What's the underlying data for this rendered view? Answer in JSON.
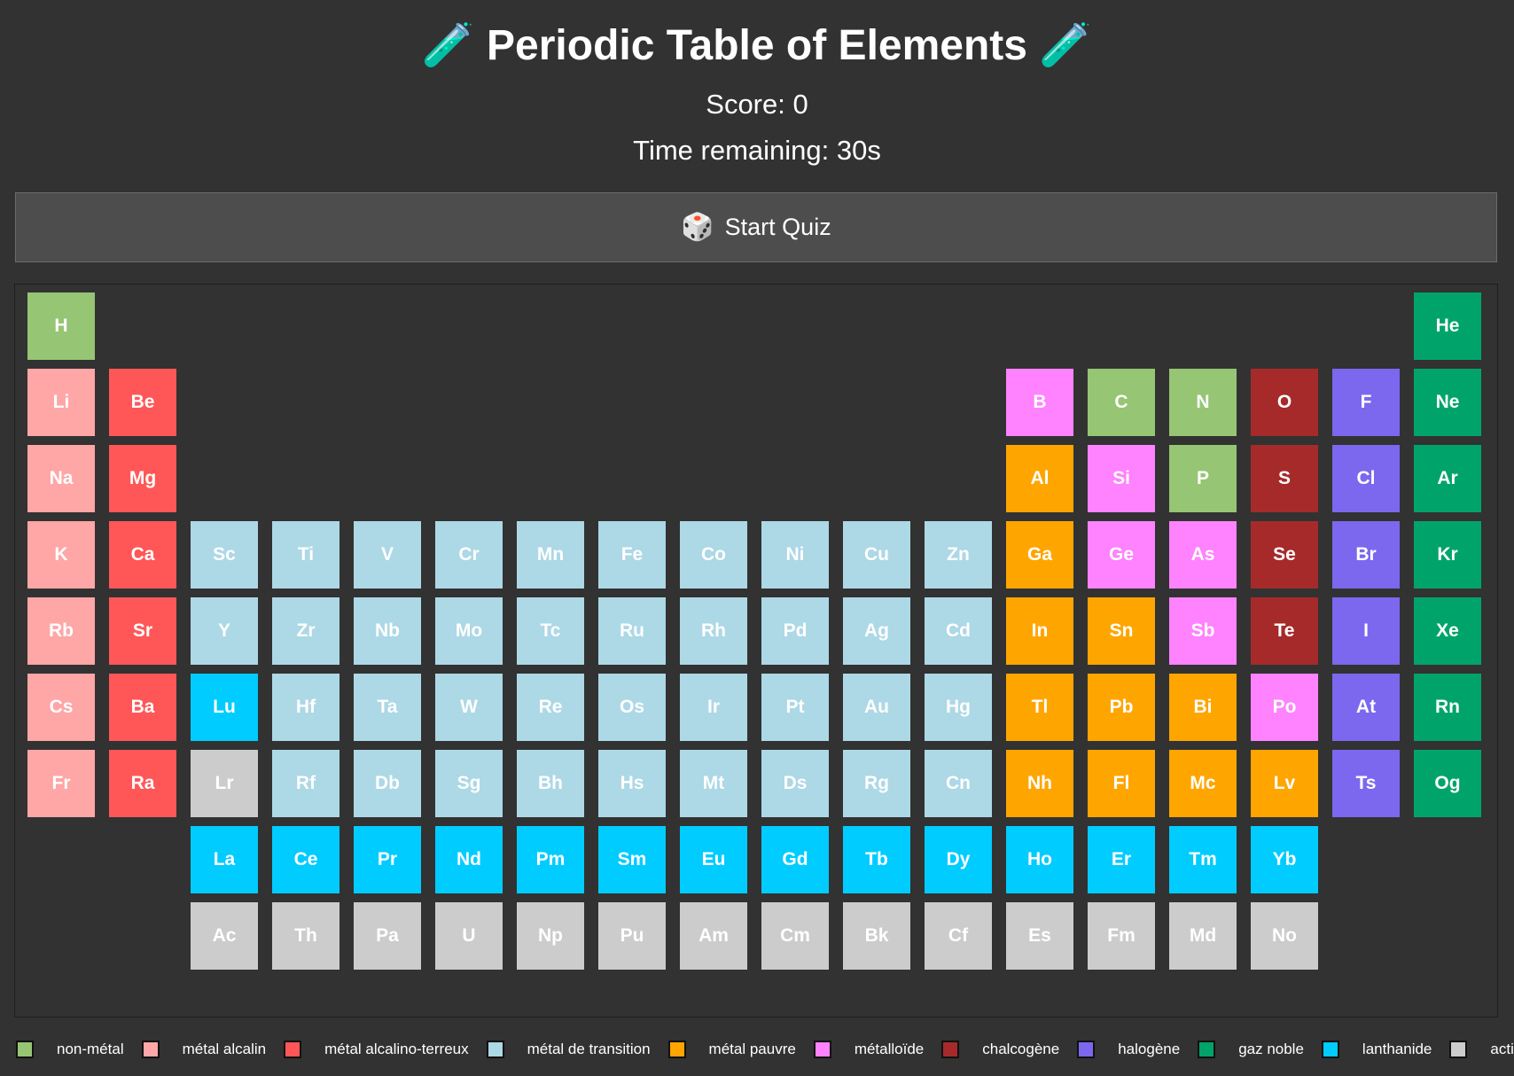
{
  "header": {
    "title_icon": "🧪",
    "title": "Periodic Table of Elements",
    "score_text": "Score: 0",
    "timer_text": "Time remaining: 30s"
  },
  "start_button": {
    "icon": "🎲",
    "label": "Start Quiz"
  },
  "colors": {
    "background": "#323232",
    "non-metal": "#96c574",
    "alkali": "#ffa6a6",
    "alkaline-earth": "#ff5757",
    "transition": "#add8e6",
    "poor-metal": "#ffa500",
    "metalloid": "#ff82ff",
    "chalcogen": "#a62a2a",
    "halogen": "#7b68ee",
    "noble-gas": "#00a46a",
    "lanthanide": "#00ccff",
    "actinide": "#cccccc"
  },
  "elements": [
    {
      "symbol": "H",
      "row": 1,
      "col": 1,
      "category": "non-metal"
    },
    {
      "symbol": "He",
      "row": 1,
      "col": 18,
      "category": "noble-gas"
    },
    {
      "symbol": "Li",
      "row": 2,
      "col": 1,
      "category": "alkali"
    },
    {
      "symbol": "Be",
      "row": 2,
      "col": 2,
      "category": "alkaline-earth"
    },
    {
      "symbol": "B",
      "row": 2,
      "col": 13,
      "category": "metalloid"
    },
    {
      "symbol": "C",
      "row": 2,
      "col": 14,
      "category": "non-metal"
    },
    {
      "symbol": "N",
      "row": 2,
      "col": 15,
      "category": "non-metal"
    },
    {
      "symbol": "O",
      "row": 2,
      "col": 16,
      "category": "chalcogen"
    },
    {
      "symbol": "F",
      "row": 2,
      "col": 17,
      "category": "halogen"
    },
    {
      "symbol": "Ne",
      "row": 2,
      "col": 18,
      "category": "noble-gas"
    },
    {
      "symbol": "Na",
      "row": 3,
      "col": 1,
      "category": "alkali"
    },
    {
      "symbol": "Mg",
      "row": 3,
      "col": 2,
      "category": "alkaline-earth"
    },
    {
      "symbol": "Al",
      "row": 3,
      "col": 13,
      "category": "poor-metal"
    },
    {
      "symbol": "Si",
      "row": 3,
      "col": 14,
      "category": "metalloid"
    },
    {
      "symbol": "P",
      "row": 3,
      "col": 15,
      "category": "non-metal"
    },
    {
      "symbol": "S",
      "row": 3,
      "col": 16,
      "category": "chalcogen"
    },
    {
      "symbol": "Cl",
      "row": 3,
      "col": 17,
      "category": "halogen"
    },
    {
      "symbol": "Ar",
      "row": 3,
      "col": 18,
      "category": "noble-gas"
    },
    {
      "symbol": "K",
      "row": 4,
      "col": 1,
      "category": "alkali"
    },
    {
      "symbol": "Ca",
      "row": 4,
      "col": 2,
      "category": "alkaline-earth"
    },
    {
      "symbol": "Sc",
      "row": 4,
      "col": 3,
      "category": "transition"
    },
    {
      "symbol": "Ti",
      "row": 4,
      "col": 4,
      "category": "transition"
    },
    {
      "symbol": "V",
      "row": 4,
      "col": 5,
      "category": "transition"
    },
    {
      "symbol": "Cr",
      "row": 4,
      "col": 6,
      "category": "transition"
    },
    {
      "symbol": "Mn",
      "row": 4,
      "col": 7,
      "category": "transition"
    },
    {
      "symbol": "Fe",
      "row": 4,
      "col": 8,
      "category": "transition"
    },
    {
      "symbol": "Co",
      "row": 4,
      "col": 9,
      "category": "transition"
    },
    {
      "symbol": "Ni",
      "row": 4,
      "col": 10,
      "category": "transition"
    },
    {
      "symbol": "Cu",
      "row": 4,
      "col": 11,
      "category": "transition"
    },
    {
      "symbol": "Zn",
      "row": 4,
      "col": 12,
      "category": "transition"
    },
    {
      "symbol": "Ga",
      "row": 4,
      "col": 13,
      "category": "poor-metal"
    },
    {
      "symbol": "Ge",
      "row": 4,
      "col": 14,
      "category": "metalloid"
    },
    {
      "symbol": "As",
      "row": 4,
      "col": 15,
      "category": "metalloid"
    },
    {
      "symbol": "Se",
      "row": 4,
      "col": 16,
      "category": "chalcogen"
    },
    {
      "symbol": "Br",
      "row": 4,
      "col": 17,
      "category": "halogen"
    },
    {
      "symbol": "Kr",
      "row": 4,
      "col": 18,
      "category": "noble-gas"
    },
    {
      "symbol": "Rb",
      "row": 5,
      "col": 1,
      "category": "alkali"
    },
    {
      "symbol": "Sr",
      "row": 5,
      "col": 2,
      "category": "alkaline-earth"
    },
    {
      "symbol": "Y",
      "row": 5,
      "col": 3,
      "category": "transition"
    },
    {
      "symbol": "Zr",
      "row": 5,
      "col": 4,
      "category": "transition"
    },
    {
      "symbol": "Nb",
      "row": 5,
      "col": 5,
      "category": "transition"
    },
    {
      "symbol": "Mo",
      "row": 5,
      "col": 6,
      "category": "transition"
    },
    {
      "symbol": "Tc",
      "row": 5,
      "col": 7,
      "category": "transition"
    },
    {
      "symbol": "Ru",
      "row": 5,
      "col": 8,
      "category": "transition"
    },
    {
      "symbol": "Rh",
      "row": 5,
      "col": 9,
      "category": "transition"
    },
    {
      "symbol": "Pd",
      "row": 5,
      "col": 10,
      "category": "transition"
    },
    {
      "symbol": "Ag",
      "row": 5,
      "col": 11,
      "category": "transition"
    },
    {
      "symbol": "Cd",
      "row": 5,
      "col": 12,
      "category": "transition"
    },
    {
      "symbol": "In",
      "row": 5,
      "col": 13,
      "category": "poor-metal"
    },
    {
      "symbol": "Sn",
      "row": 5,
      "col": 14,
      "category": "poor-metal"
    },
    {
      "symbol": "Sb",
      "row": 5,
      "col": 15,
      "category": "metalloid"
    },
    {
      "symbol": "Te",
      "row": 5,
      "col": 16,
      "category": "chalcogen"
    },
    {
      "symbol": "I",
      "row": 5,
      "col": 17,
      "category": "halogen"
    },
    {
      "symbol": "Xe",
      "row": 5,
      "col": 18,
      "category": "noble-gas"
    },
    {
      "symbol": "Cs",
      "row": 6,
      "col": 1,
      "category": "alkali"
    },
    {
      "symbol": "Ba",
      "row": 6,
      "col": 2,
      "category": "alkaline-earth"
    },
    {
      "symbol": "Lu",
      "row": 6,
      "col": 3,
      "category": "lanthanide"
    },
    {
      "symbol": "Hf",
      "row": 6,
      "col": 4,
      "category": "transition"
    },
    {
      "symbol": "Ta",
      "row": 6,
      "col": 5,
      "category": "transition"
    },
    {
      "symbol": "W",
      "row": 6,
      "col": 6,
      "category": "transition"
    },
    {
      "symbol": "Re",
      "row": 6,
      "col": 7,
      "category": "transition"
    },
    {
      "symbol": "Os",
      "row": 6,
      "col": 8,
      "category": "transition"
    },
    {
      "symbol": "Ir",
      "row": 6,
      "col": 9,
      "category": "transition"
    },
    {
      "symbol": "Pt",
      "row": 6,
      "col": 10,
      "category": "transition"
    },
    {
      "symbol": "Au",
      "row": 6,
      "col": 11,
      "category": "transition"
    },
    {
      "symbol": "Hg",
      "row": 6,
      "col": 12,
      "category": "transition"
    },
    {
      "symbol": "Tl",
      "row": 6,
      "col": 13,
      "category": "poor-metal"
    },
    {
      "symbol": "Pb",
      "row": 6,
      "col": 14,
      "category": "poor-metal"
    },
    {
      "symbol": "Bi",
      "row": 6,
      "col": 15,
      "category": "poor-metal"
    },
    {
      "symbol": "Po",
      "row": 6,
      "col": 16,
      "category": "metalloid"
    },
    {
      "symbol": "At",
      "row": 6,
      "col": 17,
      "category": "halogen"
    },
    {
      "symbol": "Rn",
      "row": 6,
      "col": 18,
      "category": "noble-gas"
    },
    {
      "symbol": "Fr",
      "row": 7,
      "col": 1,
      "category": "alkali"
    },
    {
      "symbol": "Ra",
      "row": 7,
      "col": 2,
      "category": "alkaline-earth"
    },
    {
      "symbol": "Lr",
      "row": 7,
      "col": 3,
      "category": "actinide"
    },
    {
      "symbol": "Rf",
      "row": 7,
      "col": 4,
      "category": "transition"
    },
    {
      "symbol": "Db",
      "row": 7,
      "col": 5,
      "category": "transition"
    },
    {
      "symbol": "Sg",
      "row": 7,
      "col": 6,
      "category": "transition"
    },
    {
      "symbol": "Bh",
      "row": 7,
      "col": 7,
      "category": "transition"
    },
    {
      "symbol": "Hs",
      "row": 7,
      "col": 8,
      "category": "transition"
    },
    {
      "symbol": "Mt",
      "row": 7,
      "col": 9,
      "category": "transition"
    },
    {
      "symbol": "Ds",
      "row": 7,
      "col": 10,
      "category": "transition"
    },
    {
      "symbol": "Rg",
      "row": 7,
      "col": 11,
      "category": "transition"
    },
    {
      "symbol": "Cn",
      "row": 7,
      "col": 12,
      "category": "transition"
    },
    {
      "symbol": "Nh",
      "row": 7,
      "col": 13,
      "category": "poor-metal"
    },
    {
      "symbol": "Fl",
      "row": 7,
      "col": 14,
      "category": "poor-metal"
    },
    {
      "symbol": "Mc",
      "row": 7,
      "col": 15,
      "category": "poor-metal"
    },
    {
      "symbol": "Lv",
      "row": 7,
      "col": 16,
      "category": "poor-metal"
    },
    {
      "symbol": "Ts",
      "row": 7,
      "col": 17,
      "category": "halogen"
    },
    {
      "symbol": "Og",
      "row": 7,
      "col": 18,
      "category": "noble-gas"
    },
    {
      "symbol": "La",
      "row": 8,
      "col": 3,
      "category": "lanthanide"
    },
    {
      "symbol": "Ce",
      "row": 8,
      "col": 4,
      "category": "lanthanide"
    },
    {
      "symbol": "Pr",
      "row": 8,
      "col": 5,
      "category": "lanthanide"
    },
    {
      "symbol": "Nd",
      "row": 8,
      "col": 6,
      "category": "lanthanide"
    },
    {
      "symbol": "Pm",
      "row": 8,
      "col": 7,
      "category": "lanthanide"
    },
    {
      "symbol": "Sm",
      "row": 8,
      "col": 8,
      "category": "lanthanide"
    },
    {
      "symbol": "Eu",
      "row": 8,
      "col": 9,
      "category": "lanthanide"
    },
    {
      "symbol": "Gd",
      "row": 8,
      "col": 10,
      "category": "lanthanide"
    },
    {
      "symbol": "Tb",
      "row": 8,
      "col": 11,
      "category": "lanthanide"
    },
    {
      "symbol": "Dy",
      "row": 8,
      "col": 12,
      "category": "lanthanide"
    },
    {
      "symbol": "Ho",
      "row": 8,
      "col": 13,
      "category": "lanthanide"
    },
    {
      "symbol": "Er",
      "row": 8,
      "col": 14,
      "category": "lanthanide"
    },
    {
      "symbol": "Tm",
      "row": 8,
      "col": 15,
      "category": "lanthanide"
    },
    {
      "symbol": "Yb",
      "row": 8,
      "col": 16,
      "category": "lanthanide"
    },
    {
      "symbol": "Ac",
      "row": 9,
      "col": 3,
      "category": "actinide"
    },
    {
      "symbol": "Th",
      "row": 9,
      "col": 4,
      "category": "actinide"
    },
    {
      "symbol": "Pa",
      "row": 9,
      "col": 5,
      "category": "actinide"
    },
    {
      "symbol": "U",
      "row": 9,
      "col": 6,
      "category": "actinide"
    },
    {
      "symbol": "Np",
      "row": 9,
      "col": 7,
      "category": "actinide"
    },
    {
      "symbol": "Pu",
      "row": 9,
      "col": 8,
      "category": "actinide"
    },
    {
      "symbol": "Am",
      "row": 9,
      "col": 9,
      "category": "actinide"
    },
    {
      "symbol": "Cm",
      "row": 9,
      "col": 10,
      "category": "actinide"
    },
    {
      "symbol": "Bk",
      "row": 9,
      "col": 11,
      "category": "actinide"
    },
    {
      "symbol": "Cf",
      "row": 9,
      "col": 12,
      "category": "actinide"
    },
    {
      "symbol": "Es",
      "row": 9,
      "col": 13,
      "category": "actinide"
    },
    {
      "symbol": "Fm",
      "row": 9,
      "col": 14,
      "category": "actinide"
    },
    {
      "symbol": "Md",
      "row": 9,
      "col": 15,
      "category": "actinide"
    },
    {
      "symbol": "No",
      "row": 9,
      "col": 16,
      "category": "actinide"
    }
  ],
  "legend": [
    {
      "category": "non-metal",
      "label": "non-métal"
    },
    {
      "category": "alkali",
      "label": "métal alcalin"
    },
    {
      "category": "alkaline-earth",
      "label": "métal alcalino-terreux"
    },
    {
      "category": "transition",
      "label": "métal de transition"
    },
    {
      "category": "poor-metal",
      "label": "métal pauvre"
    },
    {
      "category": "metalloid",
      "label": "métalloïde"
    },
    {
      "category": "chalcogen",
      "label": "chalcogène"
    },
    {
      "category": "halogen",
      "label": "halogène"
    },
    {
      "category": "noble-gas",
      "label": "gaz noble"
    },
    {
      "category": "lanthanide",
      "label": "lanthanide"
    },
    {
      "category": "actinide",
      "label": "actinide"
    }
  ]
}
